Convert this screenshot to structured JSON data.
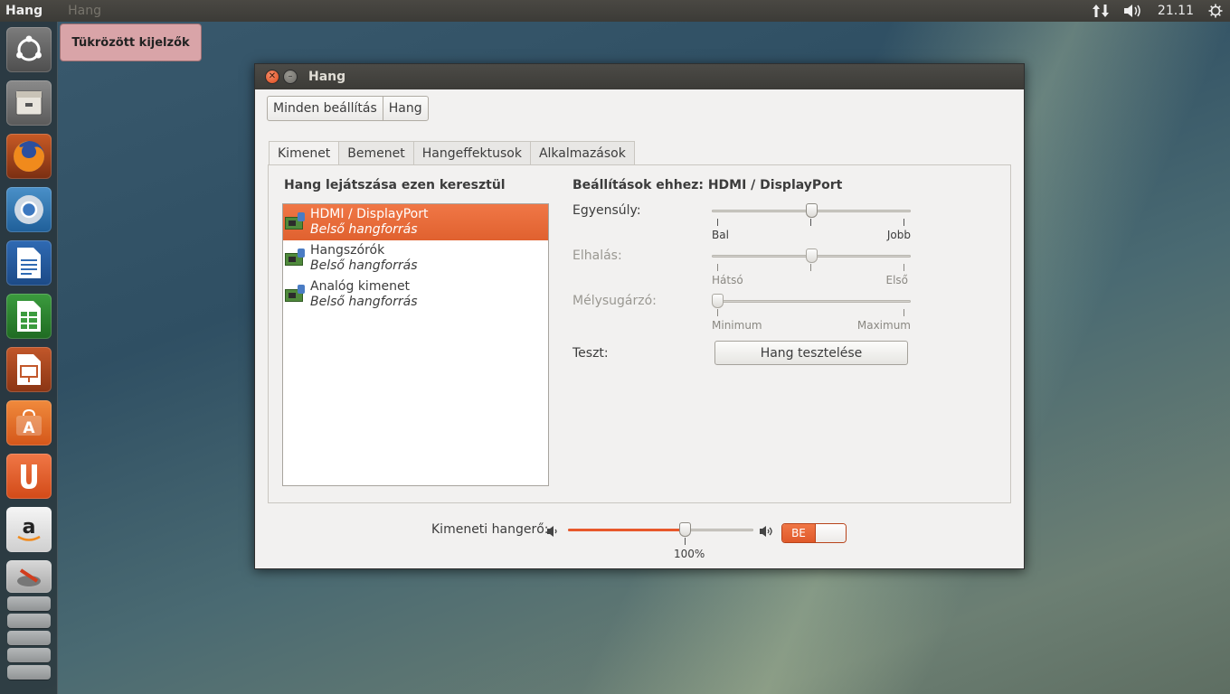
{
  "top_panel": {
    "app_title": "Hang",
    "menu_hint": "Hang",
    "clock": "21.11"
  },
  "notification": {
    "text": "Tükrözött kijelzők"
  },
  "window": {
    "title": "Hang",
    "breadcrumbs": [
      "Minden beállítás",
      "Hang"
    ],
    "tabs": [
      "Kimenet",
      "Bemenet",
      "Hangeffektusok",
      "Alkalmazások"
    ],
    "active_tab": "Kimenet",
    "output": {
      "list_title": "Hang lejátszása ezen keresztül",
      "devices": [
        {
          "name": "HDMI / DisplayPort",
          "sub": "Belső hangforrás",
          "selected": true
        },
        {
          "name": "Hangszórók",
          "sub": "Belső hangforrás",
          "selected": false
        },
        {
          "name": "Analóg kimenet",
          "sub": "Belső hangforrás",
          "selected": false
        }
      ],
      "settings_title": "Beállítások ehhez: HDMI / DisplayPort",
      "balance": {
        "label": "Egyensúly:",
        "left": "Bal",
        "right": "Jobb",
        "value": 0.5
      },
      "fade": {
        "label": "Elhalás:",
        "left": "Hátsó",
        "right": "Első",
        "value": 0.5
      },
      "subwoofer": {
        "label": "Mélysugárzó:",
        "left": "Minimum",
        "right": "Maximum",
        "value": 0.0
      },
      "test": {
        "label": "Teszt:",
        "button": "Hang tesztelése"
      }
    },
    "volume": {
      "label": "Kimeneti hangerő:",
      "percent_label": "100%",
      "value": 0.64,
      "toggle_label": "BE"
    }
  }
}
